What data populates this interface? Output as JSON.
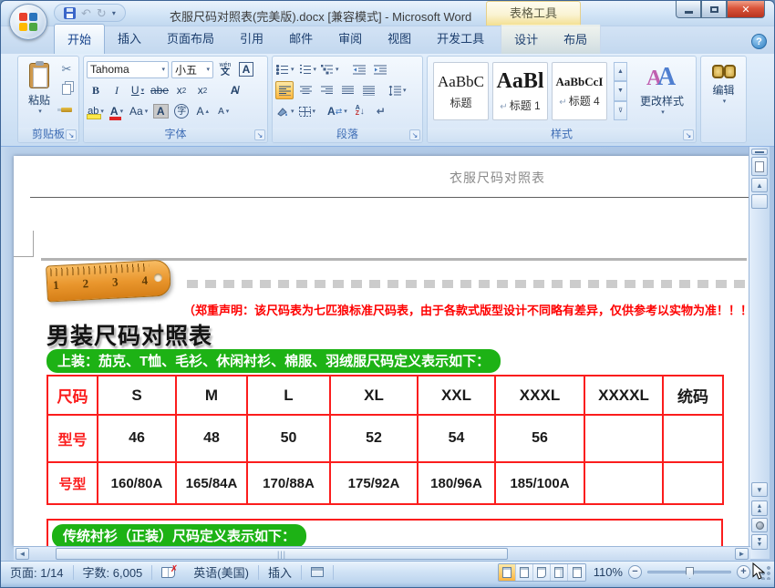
{
  "window": {
    "title": "衣服尺码对照表(完美版).docx [兼容模式] - Microsoft Word",
    "context_tool": "表格工具",
    "help_label": "?"
  },
  "tabs": {
    "main": [
      "开始",
      "插入",
      "页面布局",
      "引用",
      "邮件",
      "审阅",
      "视图",
      "开发工具"
    ],
    "contextual": [
      "设计",
      "布局"
    ],
    "active": "开始"
  },
  "ribbon": {
    "clipboard": {
      "label": "剪贴板",
      "paste": "粘贴"
    },
    "font": {
      "label": "字体",
      "family": "Tahoma",
      "size": "小五",
      "bold": "B",
      "italic": "I",
      "underline": "U",
      "strike": "abe",
      "sub": "x",
      "sup": "x",
      "highlight": "ab",
      "color": "A",
      "case": "Aa",
      "shading": "A",
      "enclose": "字",
      "grow": "A",
      "shrink": "A",
      "pinyin_top": "wén",
      "pinyin_bottom": "文",
      "border_btn": "A"
    },
    "paragraph": {
      "label": "段落",
      "sort_a": "A",
      "sort_z": "Z",
      "asian": "A"
    },
    "styles": {
      "label": "样式",
      "change": "更改样式",
      "items": [
        {
          "preview": "AaBbC",
          "mark": "",
          "name": "标题"
        },
        {
          "preview": "AaBl",
          "mark": "↵",
          "name": "标题 1"
        },
        {
          "preview": "AaBbCcI",
          "mark": "↵",
          "name": "标题 4"
        }
      ]
    },
    "edit": {
      "label": "编辑"
    }
  },
  "document": {
    "header_title": "衣服尺码对照表",
    "ruler_numbers": [
      "1",
      "2",
      "3",
      "4"
    ],
    "disclaimer": "（郑重声明：该尺码表为七匹狼标准尺码表，由于各款式版型设计不同略有差异，仅供参考以实物为准！！！）",
    "section_title": "男装尺码对照表",
    "pill_tops": "上装：茄克、T恤、毛衫、休闲衬衫、棉服、羽绒服尺码定义表示如下：",
    "pill_shirts": "传统衬衫（正装）尺码定义表示如下："
  },
  "size_table": {
    "type": "table",
    "header": [
      "尺码",
      "S",
      "M",
      "L",
      "XL",
      "XXL",
      "XXXL",
      "XXXXL",
      "统码"
    ],
    "rows": [
      [
        "型号",
        "46",
        "48",
        "50",
        "52",
        "54",
        "56",
        "",
        ""
      ],
      [
        "号型",
        "160/80A",
        "165/84A",
        "170/88A",
        "175/92A",
        "180/96A",
        "185/100A",
        "",
        ""
      ]
    ]
  },
  "statusbar": {
    "page": "页面: 1/14",
    "words": "字数: 6,005",
    "language": "英语(美国)",
    "mode": "插入",
    "zoom": "110%"
  },
  "colors": {
    "table_border": "#fb1d1d",
    "pill_green": "#1db215",
    "accent_red": "#fe0101"
  }
}
